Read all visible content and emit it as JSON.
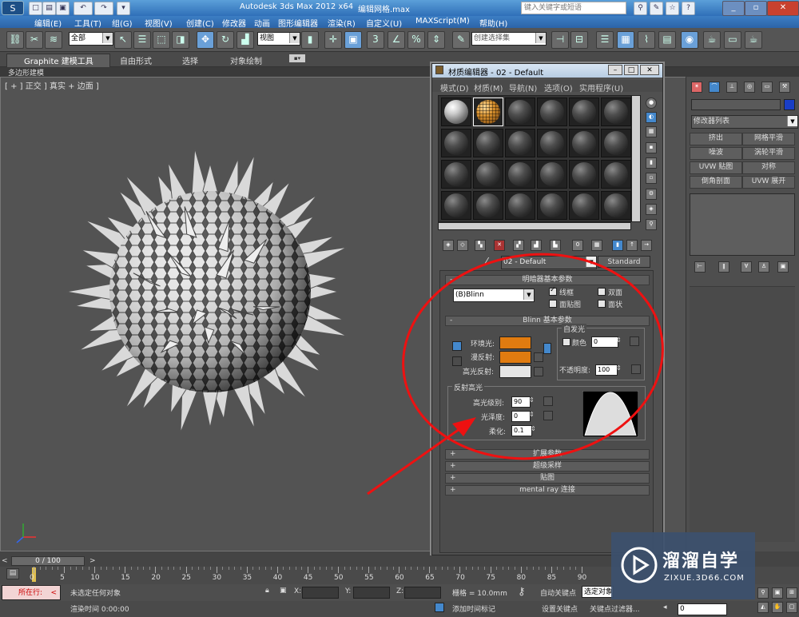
{
  "app": {
    "title": "Autodesk 3ds Max  2012 x64",
    "filename": "编辑网格.max",
    "search_placeholder": "键入关键字或短语"
  },
  "menubar": [
    "编辑(E)",
    "工具(T)",
    "组(G)",
    "视图(V)",
    "创建(C)",
    "修改器",
    "动画",
    "图形编辑器",
    "渲染(R)",
    "自定义(U)",
    "MAXScript(M)",
    "帮助(H)"
  ],
  "toolbar": {
    "selection_filter": "全部",
    "reference_coord": "视图",
    "named_selection": "创建选择集"
  },
  "ribbon": {
    "tabs": [
      "Graphite 建模工具",
      "自由形式",
      "选择",
      "对象绘制"
    ],
    "sub_label": "多边形建模"
  },
  "viewport": {
    "label": "[ + ] 正交 ] 真实 + 边面 ]"
  },
  "command_panel": {
    "modifier_list": "修改器列表",
    "modifiers": [
      "挤出",
      "网格平滑",
      "噪波",
      "涡轮平滑",
      "UVW 贴图",
      "对称",
      "倒角剖面",
      "UVW 展开"
    ]
  },
  "material_editor": {
    "title": "材质编辑器 - 02 - Default",
    "menu": [
      "模式(D)",
      "材质(M)",
      "导航(N)",
      "选项(O)",
      "实用程序(U)"
    ],
    "material_name": "02 - Default",
    "material_type": "Standard",
    "shader_rollout": {
      "title": "明暗器基本参数",
      "shader": "(B)Blinn",
      "wire": "线框",
      "two_sided": "双面",
      "face_map": "面贴图",
      "faceted": "面状",
      "wire_checked": true
    },
    "blinn_rollout": {
      "title": "Blinn 基本参数",
      "self_illum": "自发光",
      "color": "颜色",
      "self_illum_value": "0",
      "ambient": "环境光:",
      "diffuse": "漫反射:",
      "specular": "高光反射:",
      "opacity": "不透明度:",
      "opacity_value": "100",
      "ambient_color": "#e07b10",
      "diffuse_color": "#e07b10",
      "specular_color": "#e6e6e6"
    },
    "highlight": {
      "title": "反射高光",
      "spec_level": "高光级别:",
      "spec_level_value": "90",
      "glossiness": "光泽度:",
      "glossiness_value": "0",
      "soften": "柔化:",
      "soften_value": "0.1"
    },
    "collapsed_rollouts": [
      "扩展参数",
      "超级采样",
      "贴图",
      "mental ray 连接"
    ]
  },
  "timeline": {
    "frame": "0 / 100",
    "ticks": [
      "0",
      "5",
      "10",
      "15",
      "20",
      "25",
      "30",
      "35",
      "40",
      "45",
      "50",
      "55",
      "60",
      "65",
      "70",
      "75",
      "80",
      "85",
      "90"
    ]
  },
  "status": {
    "running": "所在行:",
    "selection": "未选定任何对象",
    "render_time": "渲染时间 0:00:00",
    "x": "X:",
    "y": "Y:",
    "z": "Z:",
    "grid": "栅格 = 10.0mm",
    "add_tag": "添加时间标记",
    "auto_key": "自动关键点",
    "selected_object": "选定对象",
    "set_key": "设置关键点",
    "key_filters": "关键点过滤器...",
    "frame_value": "0"
  },
  "watermark": {
    "brand": "溜溜自学",
    "url": "ZIXUE.3D66.COM"
  }
}
